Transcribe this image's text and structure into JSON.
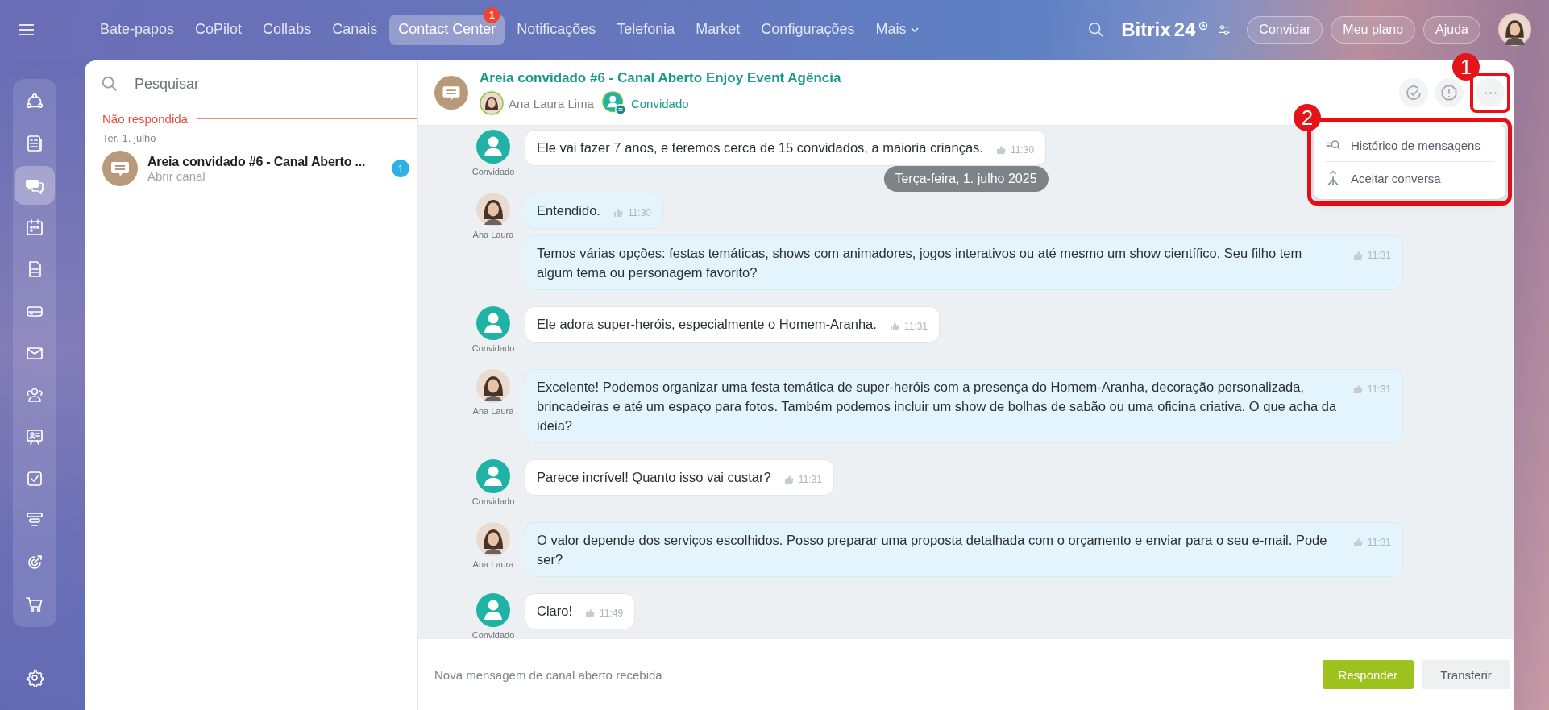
{
  "nav": {
    "tabs": [
      {
        "label": "Bate-papos",
        "selected": false
      },
      {
        "label": "CoPilot",
        "selected": false
      },
      {
        "label": "Collabs",
        "selected": false
      },
      {
        "label": "Canais",
        "selected": false
      },
      {
        "label": "Contact Center",
        "selected": true,
        "badge": "1"
      },
      {
        "label": "Notificações",
        "selected": false
      },
      {
        "label": "Telefonia",
        "selected": false
      },
      {
        "label": "Market",
        "selected": false
      },
      {
        "label": "Configurações",
        "selected": false
      },
      {
        "label": "Mais",
        "selected": false,
        "dropdown": true
      }
    ]
  },
  "top_right": {
    "logo": "Bitrix",
    "logo_number": "24",
    "buttons": [
      "Convidar",
      "Meu plano",
      "Ajuda"
    ]
  },
  "rail": {
    "items": [
      {
        "selected": false
      },
      {
        "selected": false
      },
      {
        "selected": true
      },
      {
        "selected": false
      },
      {
        "selected": false
      },
      {
        "selected": false
      },
      {
        "selected": false
      },
      {
        "selected": false
      },
      {
        "selected": false
      },
      {
        "selected": false
      },
      {
        "selected": false
      },
      {
        "selected": false
      },
      {
        "selected": false
      }
    ]
  },
  "list": {
    "search": {
      "placeholder": "Pesquisar"
    },
    "section": "Não respondida",
    "date": "Ter, 1. julho",
    "items": [
      {
        "title": "Areia convidado #6 - Canal Aberto ...",
        "subtitle": "Abrir canal",
        "badge": "1"
      }
    ]
  },
  "chat": {
    "title": "Areia convidado #6 - Canal Aberto Enjoy Event Agência",
    "participants": [
      {
        "kind": "operator",
        "name": "Ana Laura Lima"
      },
      {
        "kind": "guest",
        "name": "Convidado"
      }
    ],
    "date_divider": "Terça-feira, 1. julho 2025",
    "groups": [
      {
        "kind": "guest",
        "author": "Convidado",
        "messages": [
          {
            "text": "Ele vai fazer 7 anos, e teremos cerca de 15 convidados, a maioria crianças.",
            "time": "11:30"
          }
        ]
      },
      {
        "kind": "operator",
        "author": "Ana Laura",
        "messages": [
          {
            "text": "Entendido.",
            "time": "11:30"
          },
          {
            "text": "Temos várias opções: festas temáticas, shows com animadores, jogos interativos ou até mesmo um show científico. Seu filho tem algum tema ou personagem favorito?",
            "time": "11:31"
          }
        ]
      },
      {
        "kind": "guest",
        "author": "Convidado",
        "messages": [
          {
            "text": "Ele adora super-heróis, especialmente o Homem-Aranha.",
            "time": "11:31"
          }
        ]
      },
      {
        "kind": "operator",
        "author": "Ana Laura",
        "messages": [
          {
            "text": "Excelente! Podemos organizar uma festa temática de super-heróis com a presença do Homem-Aranha, decoração personalizada, brincadeiras e até um espaço para fotos. Também podemos incluir um show de bolhas de sabão ou uma oficina criativa. O que acha da ideia?",
            "time": "11:31"
          }
        ]
      },
      {
        "kind": "guest",
        "author": "Convidado",
        "messages": [
          {
            "text": "Parece incrível! Quanto isso vai custar?",
            "time": "11:31"
          }
        ]
      },
      {
        "kind": "operator",
        "author": "Ana Laura",
        "messages": [
          {
            "text": "O valor depende dos serviços escolhidos. Posso preparar uma proposta detalhada com o orçamento e enviar para o seu e-mail. Pode ser?",
            "time": "11:31"
          }
        ]
      },
      {
        "kind": "guest",
        "author": "Convidado",
        "messages": [
          {
            "text": "Claro!",
            "time": "11:49"
          }
        ]
      }
    ],
    "menu": {
      "items": [
        {
          "kind": "history",
          "label": "Histórico de mensagens"
        },
        {
          "kind": "accept",
          "label": "Aceitar conversa"
        }
      ]
    },
    "annotations": [
      "1",
      "2"
    ],
    "footer": {
      "status": "Nova mensagem de canal aberto recebida",
      "buttons": [
        {
          "kind": "primary",
          "label": "Responder"
        },
        {
          "kind": "secondary",
          "label": "Transferir"
        }
      ]
    }
  }
}
